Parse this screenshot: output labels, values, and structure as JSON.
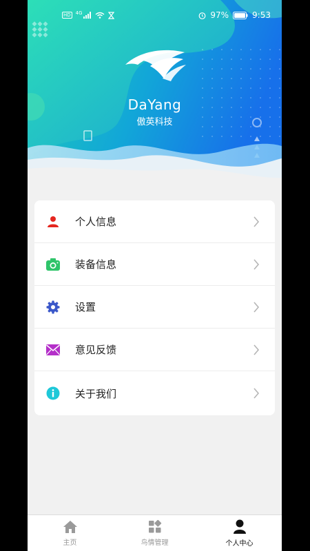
{
  "status_bar": {
    "network_badge": "HD",
    "signal_type": "4G",
    "battery": "97%",
    "time": "9:53",
    "icons": [
      "signal-icon",
      "wifi-icon",
      "hourglass-icon",
      "alarm-icon",
      "battery-icon"
    ]
  },
  "brand": {
    "name": "DaYang",
    "subtitle": "傲英科技",
    "logo_icon": "bird-wings-logo"
  },
  "menu": {
    "items": [
      {
        "label": "个人信息",
        "icon": "person-icon",
        "color": "#e5261f"
      },
      {
        "label": "装备信息",
        "icon": "camera-icon",
        "color": "#2fc46a"
      },
      {
        "label": "设置",
        "icon": "gear-icon",
        "color": "#3a57c9"
      },
      {
        "label": "意见反馈",
        "icon": "mail-icon",
        "color": "#b42fc9"
      },
      {
        "label": "关于我们",
        "icon": "info-icon",
        "color": "#1ec8d8"
      }
    ]
  },
  "tabbar": {
    "tabs": [
      {
        "label": "主页",
        "icon": "home-icon",
        "active": false
      },
      {
        "label": "鸟情管理",
        "icon": "grid-icon",
        "active": false
      },
      {
        "label": "个人中心",
        "icon": "user-icon",
        "active": true
      }
    ]
  },
  "colors": {
    "hero_gradient_start": "#1ecfb6",
    "hero_gradient_end": "#1a7be8",
    "background": "#f1f1f1",
    "chevron": "#b5b5b5"
  }
}
